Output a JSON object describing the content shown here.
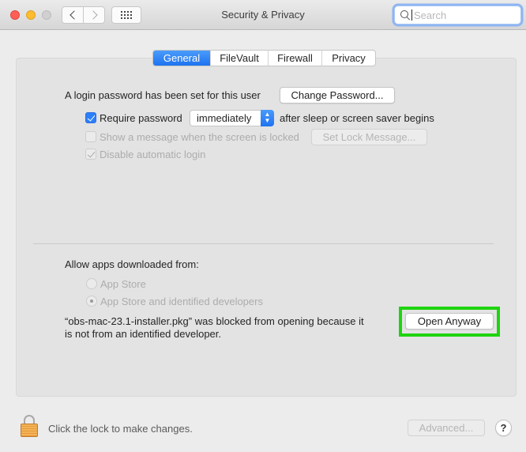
{
  "window": {
    "title": "Security & Privacy",
    "search_placeholder": "Search",
    "search_value": ""
  },
  "tabs": [
    {
      "label": "General",
      "active": true
    },
    {
      "label": "FileVault",
      "active": false
    },
    {
      "label": "Firewall",
      "active": false
    },
    {
      "label": "Privacy",
      "active": false
    }
  ],
  "general": {
    "login_password_text": "A login password has been set for this user",
    "change_password_label": "Change Password...",
    "require_password": {
      "label": "Require password",
      "checked": true
    },
    "require_password_delay": "immediately",
    "after_sleep_text": "after sleep or screen saver begins",
    "show_message": {
      "label": "Show a message when the screen is locked",
      "checked": false,
      "enabled": false
    },
    "set_lock_message_label": "Set Lock Message...",
    "disable_auto_login": {
      "label": "Disable automatic login",
      "checked": true,
      "enabled": false
    }
  },
  "allow_apps": {
    "heading": "Allow apps downloaded from:",
    "options": [
      {
        "label": "App Store",
        "selected": false
      },
      {
        "label": "App Store and identified developers",
        "selected": true
      }
    ],
    "blocked_message_line1": "“obs-mac-23.1-installer.pkg” was blocked from opening because it",
    "blocked_message_line2": "is not from an identified developer.",
    "open_anyway_label": "Open Anyway",
    "highlight_color": "#1ed40f"
  },
  "footer": {
    "lock_text": "Click the lock to make changes.",
    "advanced_label": "Advanced...",
    "help_label": "?"
  },
  "icons": {
    "lock": "lock-icon",
    "search": "search-icon",
    "grid": "grid-icon",
    "back": "chevron-left-icon",
    "forward": "chevron-right-icon"
  }
}
